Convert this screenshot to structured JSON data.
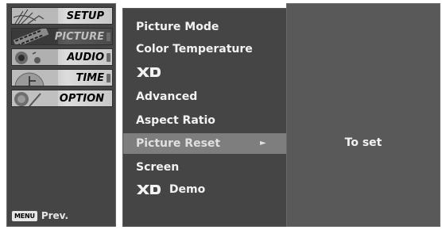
{
  "categories": [
    {
      "label": "SETUP",
      "icon": "antenna-icon",
      "state": "normal"
    },
    {
      "label": "PICTURE",
      "icon": "film-icon",
      "state": "active"
    },
    {
      "label": "AUDIO",
      "icon": "speaker-icon",
      "state": "normal"
    },
    {
      "label": "TIME",
      "icon": "clock-icon",
      "state": "normal"
    },
    {
      "label": "OPTION",
      "icon": "option-icon",
      "state": "normal"
    }
  ],
  "footer": {
    "menu_key": "MENU",
    "prev_label": "Prev."
  },
  "submenu": {
    "items": [
      {
        "label": "Picture Mode"
      },
      {
        "label": "Color Temperature"
      },
      {
        "label": "XD"
      },
      {
        "label": "Advanced"
      },
      {
        "label": "Aspect Ratio"
      },
      {
        "label": "Picture Reset",
        "selected": true,
        "arrow": "►"
      },
      {
        "label": "Screen"
      },
      {
        "label": "Demo",
        "logo": "XD"
      }
    ]
  },
  "value_panel": {
    "text": "To set"
  },
  "colors": {
    "panel": "#454545",
    "selected_row": "#7e7e7e",
    "value_panel": "#595959",
    "text": "#f2f2f2"
  }
}
